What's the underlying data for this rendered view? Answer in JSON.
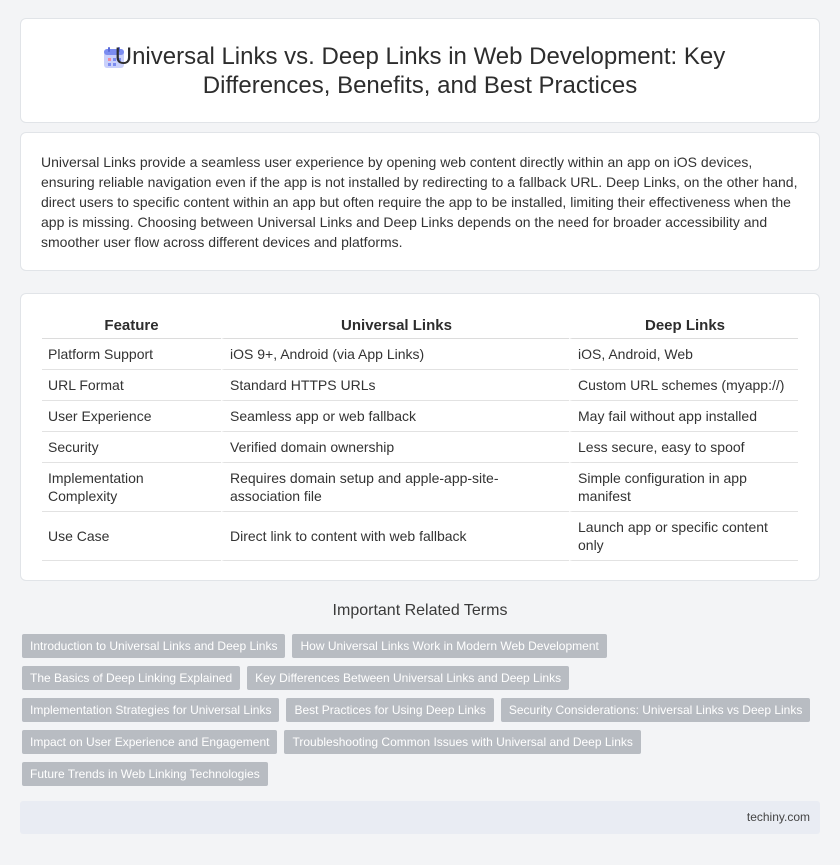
{
  "header": {
    "title": "Universal Links vs. Deep Links in Web Development: Key Differences, Benefits, and Best Practices",
    "icon": "calendar-icon"
  },
  "summary": "Universal Links provide a seamless user experience by opening web content directly within an app on iOS devices, ensuring reliable navigation even if the app is not installed by redirecting to a fallback URL. Deep Links, on the other hand, direct users to specific content within an app but often require the app to be installed, limiting their effectiveness when the app is missing. Choosing between Universal Links and Deep Links depends on the need for broader accessibility and smoother user flow across different devices and platforms.",
  "table": {
    "headers": [
      "Feature",
      "Universal Links",
      "Deep Links"
    ],
    "rows": [
      [
        "Platform Support",
        "iOS 9+, Android (via App Links)",
        "iOS, Android, Web"
      ],
      [
        "URL Format",
        "Standard HTTPS URLs",
        "Custom URL schemes (myapp://)"
      ],
      [
        "User Experience",
        "Seamless app or web fallback",
        "May fail without app installed"
      ],
      [
        "Security",
        "Verified domain ownership",
        "Less secure, easy to spoof"
      ],
      [
        "Implementation Complexity",
        "Requires domain setup and apple-app-site-association file",
        "Simple configuration in app manifest"
      ],
      [
        "Use Case",
        "Direct link to content with web fallback",
        "Launch app or specific content only"
      ]
    ]
  },
  "related": {
    "heading": "Important Related Terms",
    "rows": [
      [
        "Introduction to Universal Links and Deep Links",
        "How Universal Links Work in Modern Web Development"
      ],
      [
        "The Basics of Deep Linking Explained",
        "Key Differences Between Universal Links and Deep Links"
      ],
      [
        "Implementation Strategies for Universal Links",
        "Best Practices for Using Deep Links",
        "Security Considerations: Universal Links vs Deep Links"
      ],
      [
        "Impact on User Experience and Engagement",
        "Troubleshooting Common Issues with Universal and Deep Links"
      ],
      [
        "Future Trends in Web Linking Technologies"
      ]
    ]
  },
  "footer": {
    "site": "techiny.com"
  },
  "colors": {
    "tag_bg": "#b8bcc2",
    "footer_bg": "#e9ecf3",
    "icon_accent": "#7b8cf0"
  }
}
